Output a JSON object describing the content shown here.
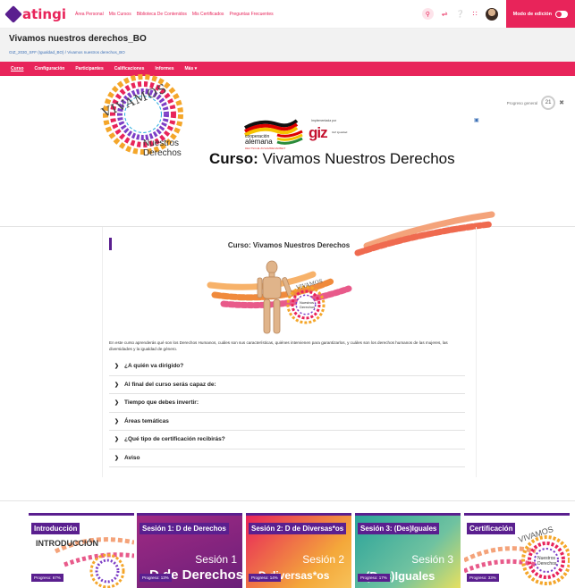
{
  "topbar": {
    "logo": "atingi",
    "nav": [
      "Área Personal",
      "Mis Cursos",
      "Biblioteca De Contenidos",
      "Mis Certificados",
      "Preguntas Frecuentes"
    ],
    "edit_mode": "Modo de edición",
    "icons": [
      "search-icon",
      "language-icon",
      "help-icon",
      "apps-icon",
      "avatar"
    ]
  },
  "header": {
    "title": "Vivamos nuestros derechos_BO",
    "breadcrumb": "GIZ_2030_SFF (Igualdad_BO) / Vivamos nuestros derechos_BO"
  },
  "course_nav": [
    "Curso",
    "Configuración",
    "Participantes",
    "Calificaciones",
    "Informes",
    "Más ▾"
  ],
  "banner": {
    "progress_label": "Progreso general",
    "progress_value": "21",
    "coop_line1": "cooperación",
    "coop_line2": "alemana",
    "coop_line3": "DEUTSCHE ZUSAMMENARBEIT",
    "implemented_by": "Implementada por",
    "giz": "giz",
    "giz_tag": "GIZ Igualdad",
    "vivamos": "VIVAMOS",
    "nuestros": "Nuestros",
    "derechos": "Derechos",
    "title_bold": "Curso:",
    "title_rest": " Vivamos Nuestros Derechos"
  },
  "section": {
    "title": "Curso: Vivamos Nuestros Derechos",
    "description": "En este curso aprenderás qué son los Derechos Humanos, cuáles son sus características, quiénes intervienen para garantizarlos, y cuáles son los derechos humanos de las mujeres, las diversidades y la igualdad de género.",
    "accordion": [
      "¿A quién va dirigido?",
      "Al final del curso serás capaz de:",
      "Tiempo que debes invertir:",
      "Áreas temáticas",
      "¿Qué tipo de certificación recibirás?",
      "Aviso"
    ]
  },
  "cards": [
    {
      "title": "Introducción",
      "progress": "Progreso: 67%",
      "big": "INTRODUCCIÓN",
      "bg": "#ffffff"
    },
    {
      "title": "Sesión 1: D de Derechos",
      "progress": "Progreso: 13%",
      "big": "Sesión 1",
      "big2": "D de Derechos",
      "bg": "#8e2a8c"
    },
    {
      "title": "Sesión 2: D de Diversas*os",
      "progress": "Progreso: 14%",
      "big": "Sesión 2",
      "big2": "D diversas*os",
      "bg": "#ee6d3e"
    },
    {
      "title": "Sesión 3: (Des)Iguales",
      "progress": "Progreso: 17%",
      "big": "Sesión 3",
      "big2": "(Des)Iguales",
      "bg": "#3fae9b"
    },
    {
      "title": "Certificación",
      "progress": "Progreso: 33%",
      "big": "VIVAMOS",
      "bg": "#ffffff"
    }
  ],
  "colors": {
    "accent": "#e8245a",
    "purple": "#5a1f8f"
  }
}
